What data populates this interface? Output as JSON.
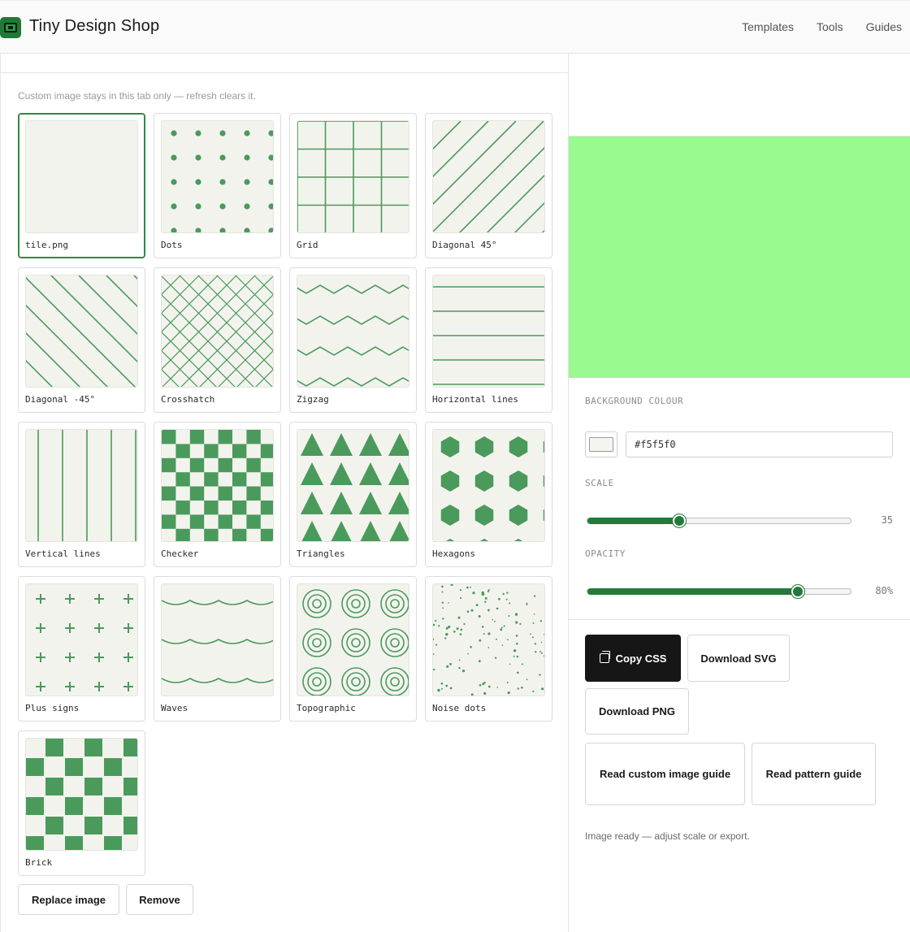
{
  "header": {
    "brand": "Tiny Design Shop",
    "logo_icon": "image-frame-icon",
    "nav": [
      "Templates",
      "Tools",
      "Guides"
    ]
  },
  "left": {
    "hint": "Custom image stays in this tab only — refresh clears it.",
    "patterns": [
      {
        "label": "tile.png",
        "kind": "blank",
        "selected": true
      },
      {
        "label": "Dots",
        "kind": "dots"
      },
      {
        "label": "Grid",
        "kind": "grid"
      },
      {
        "label": "Diagonal 45°",
        "kind": "diag45"
      },
      {
        "label": "Diagonal -45°",
        "kind": "diagm45"
      },
      {
        "label": "Crosshatch",
        "kind": "crosshatch"
      },
      {
        "label": "Zigzag",
        "kind": "zigzag"
      },
      {
        "label": "Horizontal lines",
        "kind": "hlines"
      },
      {
        "label": "Vertical lines",
        "kind": "vlines"
      },
      {
        "label": "Checker",
        "kind": "checker"
      },
      {
        "label": "Triangles",
        "kind": "triangles"
      },
      {
        "label": "Hexagons",
        "kind": "hexagons"
      },
      {
        "label": "Plus signs",
        "kind": "plus"
      },
      {
        "label": "Waves",
        "kind": "waves"
      },
      {
        "label": "Topographic",
        "kind": "topo"
      },
      {
        "label": "Noise dots",
        "kind": "noise"
      },
      {
        "label": "Brick",
        "kind": "brick"
      }
    ],
    "replace_label": "Replace image",
    "remove_label": "Remove"
  },
  "right": {
    "preview_color": "#98fa8f",
    "bg_label": "BACKGROUND COLOUR",
    "bg_value": "#f5f5f0",
    "scale_label": "SCALE",
    "scale_value": "35",
    "scale_fraction": 0.35,
    "opacity_label": "OPACITY",
    "opacity_value": "80%",
    "opacity_fraction": 0.8,
    "copy_css": "Copy CSS",
    "download_svg": "Download SVG",
    "download_png": "Download PNG",
    "custom_guide": "Read custom image guide",
    "pattern_guide": "Read pattern guide",
    "status": "Image ready — adjust scale or export."
  },
  "colors": {
    "accent": "#237a3a",
    "pattern": "#4a9a5c",
    "tile_bg": "#f3f3ee"
  }
}
